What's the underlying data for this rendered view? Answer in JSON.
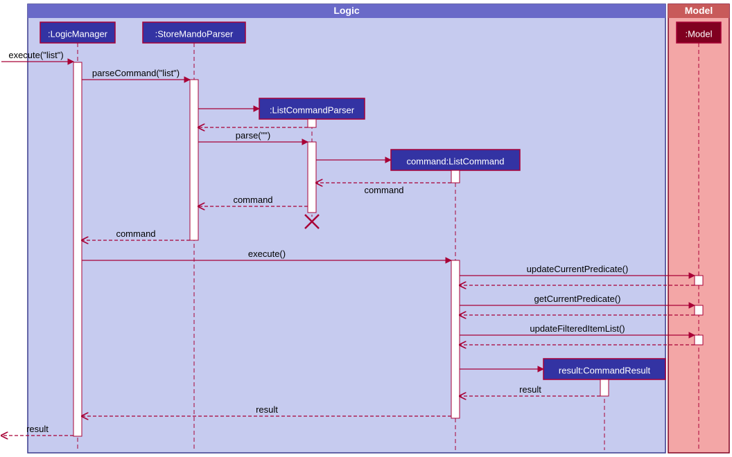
{
  "frames": {
    "logic": {
      "title": "Logic"
    },
    "model": {
      "title": "Model"
    }
  },
  "participants": {
    "logicManager": ":LogicManager",
    "storeMandoParser": ":StoreMandoParser",
    "listCommandParser": ":ListCommandParser",
    "listCommand": "command:ListCommand",
    "commandResult": "result:CommandResult",
    "model": ":Model"
  },
  "messages": {
    "executeList": "execute(\"list\")",
    "parseCommand": "parseCommand(\"list\")",
    "parseEmpty": "parse(\"\")",
    "commandRet1": "command",
    "commandRet2": "command",
    "commandRet3": "command",
    "executeCall": "execute()",
    "updateCurrentPredicate": "updateCurrentPredicate()",
    "getCurrentPredicate": "getCurrentPredicate()",
    "updateFilteredItemList": "updateFilteredItemList()",
    "resultRet1": "result",
    "resultRet2": "result",
    "resultRet3": "result"
  }
}
